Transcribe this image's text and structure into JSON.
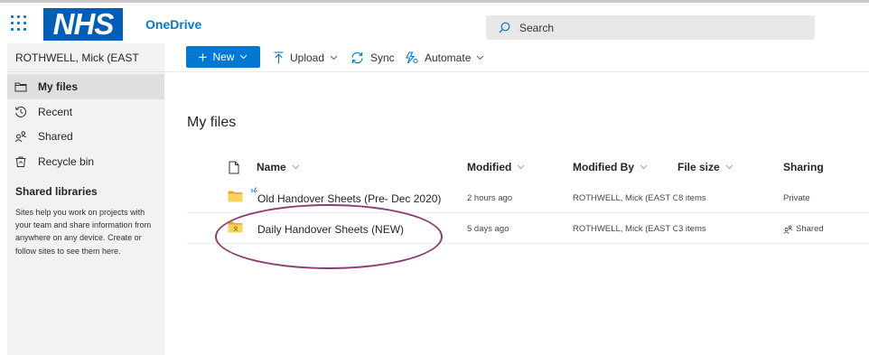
{
  "header": {
    "logo_text": "NHS",
    "app_name": "OneDrive",
    "search_placeholder": "Search"
  },
  "sidebar": {
    "account_name": "ROTHWELL, Mick (EAST",
    "nav": [
      {
        "label": "My files",
        "icon": "folder-icon",
        "selected": true
      },
      {
        "label": "Recent",
        "icon": "clock-icon",
        "selected": false
      },
      {
        "label": "Shared",
        "icon": "people-icon",
        "selected": false
      },
      {
        "label": "Recycle bin",
        "icon": "recycle-bin-icon",
        "selected": false
      }
    ],
    "shared_libraries_title": "Shared libraries",
    "shared_libraries_desc": "Sites help you work on projects with your team and share information from anywhere on any device. Create or follow sites to see them here."
  },
  "commands": {
    "new_label": "New",
    "upload_label": "Upload",
    "sync_label": "Sync",
    "automate_label": "Automate"
  },
  "main": {
    "title": "My files",
    "columns": {
      "name": "Name",
      "modified": "Modified",
      "modified_by": "Modified By",
      "file_size": "File size",
      "sharing": "Sharing"
    },
    "rows": [
      {
        "name": "Old Handover Sheets (Pre- Dec 2020)",
        "modified": "2 hours ago",
        "modified_by": "ROTHWELL, Mick (EAST CH",
        "file_size": "8 items",
        "sharing": "Private",
        "is_new": true
      },
      {
        "name": "Daily Handover Sheets (NEW)",
        "modified": "5 days ago",
        "modified_by": "ROTHWELL, Mick (EAST CH",
        "file_size": "3 items",
        "sharing": "Shared",
        "is_new": false
      }
    ]
  },
  "colors": {
    "accent": "#0078d4",
    "nhs_blue": "#005eb8",
    "folder": "#f4c542",
    "annotation": "#8a3d70"
  }
}
